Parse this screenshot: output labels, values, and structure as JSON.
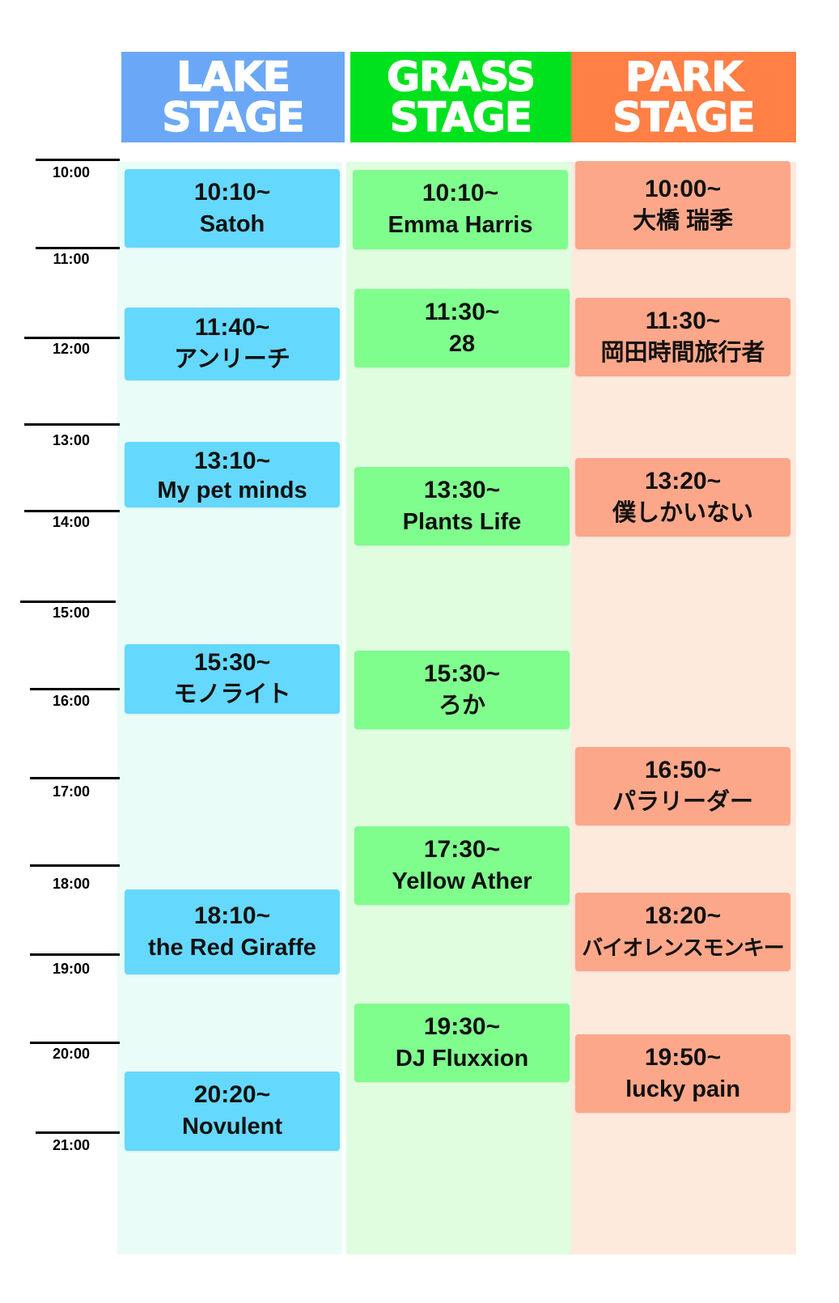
{
  "colors": {
    "lake_header": "#6aa8f7",
    "grass_header": "#00e21e",
    "park_header": "#ff7f45",
    "lake_col": "#e9fcf8",
    "grass_col": "#e0fde0",
    "park_col": "#fdeadd",
    "lake_slot": "#65d8fd",
    "grass_slot": "#7ffd8d",
    "park_slot": "#fca789"
  },
  "stages": [
    {
      "line1": "LAKE",
      "line2": "STAGE",
      "slots": [
        {
          "time": "10:10~",
          "artist": "Satoh"
        },
        {
          "time": "11:40~",
          "artist": "アンリーチ"
        },
        {
          "time": "13:10~",
          "artist": "My pet minds"
        },
        {
          "time": "15:30~",
          "artist": "モノライト"
        },
        {
          "time": "18:10~",
          "artist": "the Red Giraffe"
        },
        {
          "time": "20:20~",
          "artist": "Novulent"
        }
      ]
    },
    {
      "line1": "GRASS",
      "line2": "STAGE",
      "slots": [
        {
          "time": "10:10~",
          "artist": "Emma Harris"
        },
        {
          "time": "11:30~",
          "artist": "28"
        },
        {
          "time": "13:30~",
          "artist": "Plants Life"
        },
        {
          "time": "15:30~",
          "artist": "ろか"
        },
        {
          "time": "17:30~",
          "artist": "Yellow Ather"
        },
        {
          "time": "19:30~",
          "artist": "DJ Fluxxion"
        }
      ]
    },
    {
      "line1": "PARK",
      "line2": "STAGE",
      "slots": [
        {
          "time": "10:00~",
          "artist": "大橋 瑞季"
        },
        {
          "time": "11:30~",
          "artist": "岡田時間旅行者"
        },
        {
          "time": "13:20~",
          "artist": "僕しかいない"
        },
        {
          "time": "16:50~",
          "artist": "パラリーダー"
        },
        {
          "time": "18:20~",
          "artist": "バイオレンスモンキー"
        },
        {
          "time": "19:50~",
          "artist": "lucky pain"
        }
      ]
    }
  ],
  "hours": [
    "10:00",
    "11:00",
    "12:00",
    "13:00",
    "14:00",
    "15:00",
    "16:00",
    "17:00",
    "18:00",
    "19:00",
    "20:00",
    "21:00"
  ]
}
